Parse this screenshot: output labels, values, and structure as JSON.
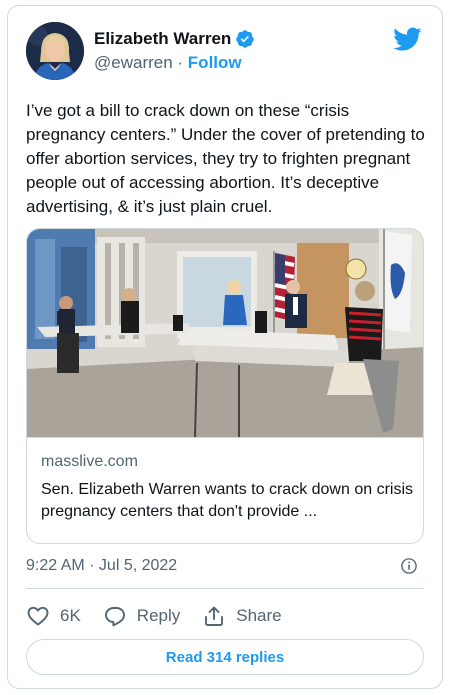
{
  "author": {
    "name": "Elizabeth Warren",
    "handle": "@ewarren",
    "separator": " · ",
    "follow_label": "Follow"
  },
  "tweet": {
    "text": "I’ve got a bill to crack down on these “crisis pregnancy centers.” Under the cover of pretending to offer abortion services, they try to frighten pregnant people out of accessing abortion. It’s deceptive advertising, & it’s just plain cruel.",
    "timestamp": "9:22 AM · Jul 5, 2022"
  },
  "link_card": {
    "domain": "masslive.com",
    "title": "Sen. Elizabeth Warren wants to crack down on crisis pregnancy centers that don't provide ..."
  },
  "actions": {
    "like_count": "6K",
    "reply_label": "Reply",
    "share_label": "Share"
  },
  "read_replies_label": "Read 314 replies",
  "icons": {
    "brand": "twitter-bird-icon",
    "verified": "verified-badge-icon",
    "like": "heart-icon",
    "reply": "speech-bubble-icon",
    "share": "share-icon",
    "info": "info-icon"
  },
  "colors": {
    "accent": "#1d9bf0",
    "text": "#0f1419",
    "secondary": "#536471",
    "border": "#cfd9de"
  }
}
